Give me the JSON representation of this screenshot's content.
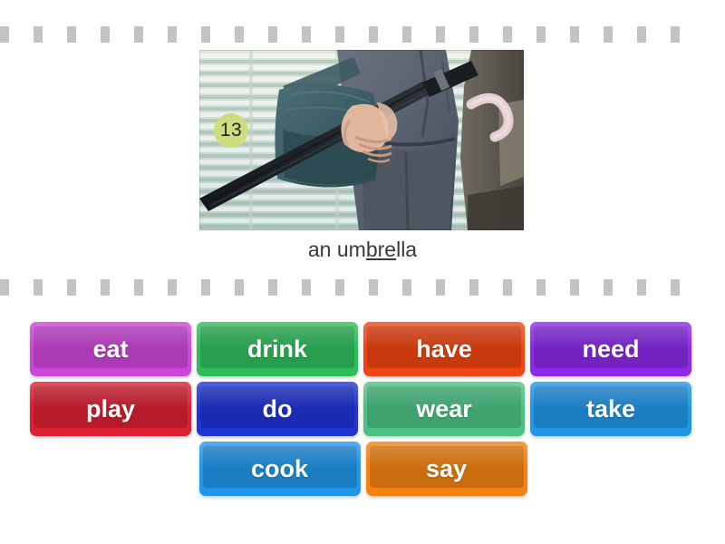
{
  "dividers": {
    "dash_color": "#c3c3c3",
    "dash_count": 21
  },
  "prompt": {
    "badge_number": "13",
    "badge_color": "#cddc7e",
    "caption_before": "an um",
    "caption_underlined": "bre",
    "caption_after": "lla",
    "caption_full": "an umbrella",
    "image_alt": "person-in-suit-holding-umbrella-and-bag"
  },
  "tiles": {
    "rows": [
      [
        {
          "label": "eat",
          "color": "#cc46d8",
          "name": "tile-eat"
        },
        {
          "label": "drink",
          "color": "#2ebd5b",
          "name": "tile-drink"
        },
        {
          "label": "have",
          "color": "#ef4413",
          "name": "tile-have"
        },
        {
          "label": "need",
          "color": "#8b2ae8",
          "name": "tile-need"
        }
      ],
      [
        {
          "label": "play",
          "color": "#dc1f33",
          "name": "tile-play"
        },
        {
          "label": "do",
          "color": "#2034d6",
          "name": "tile-do"
        },
        {
          "label": "wear",
          "color": "#4cc184",
          "name": "tile-wear"
        },
        {
          "label": "take",
          "color": "#2196e8",
          "name": "tile-take"
        }
      ],
      [
        {
          "label": "cook",
          "color": "#2196e8",
          "name": "tile-cook"
        },
        {
          "label": "say",
          "color": "#f28211",
          "name": "tile-say"
        }
      ]
    ]
  }
}
